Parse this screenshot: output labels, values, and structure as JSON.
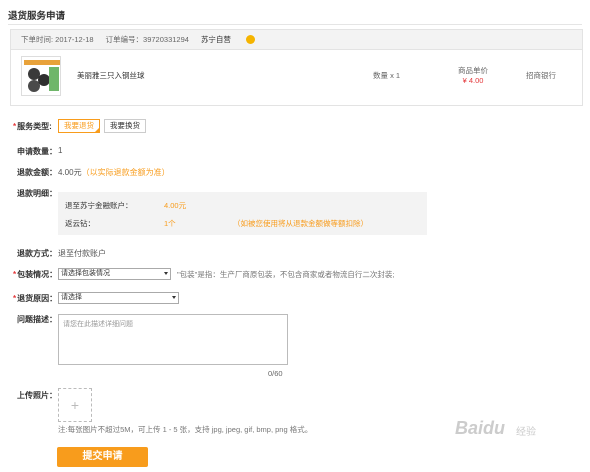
{
  "page": {
    "title": "退货服务申请"
  },
  "order": {
    "date": "下单时间: 2017-12-18",
    "order_no": "订单编号：39720331294",
    "store": "苏宁自营",
    "product_name": "美丽雅三只入钢丝球",
    "qty": "数量 x 1",
    "price_label": "商品单价",
    "price": "¥ 4.00",
    "seller": "招商银行"
  },
  "form": {
    "service_type": {
      "label": "服务类型:",
      "options": [
        "我要退货",
        "我要换货"
      ],
      "selected": "我要退货"
    },
    "apply_qty": {
      "label": "申请数量：",
      "value": "1"
    },
    "refund_amount": {
      "label": "退款金额：",
      "value": "4.00元",
      "note": "（以实际退款金额为准）"
    },
    "refund_detail": {
      "label": "退款明细：",
      "rows": [
        {
          "name": "退至苏宁金融账户：",
          "amount": "4.00元",
          "note": ""
        },
        {
          "name": "返云钻：",
          "amount": "1个",
          "note": "（如被您使用将从退款金额做等额扣除）"
        }
      ]
    },
    "refund_method": {
      "label": "退款方式：",
      "value": "退至付款账户"
    },
    "package": {
      "label": "包装情况：",
      "placeholder": "请选择包装情况",
      "hint": "\"包装\"是指：生产厂商原包装，不包含商家或者物流自行二次封装;"
    },
    "reason": {
      "label": "退货原因：",
      "placeholder": "请选择"
    },
    "description": {
      "label": "问题描述：",
      "placeholder": "请您在此描述详细问题",
      "counter": "0/60"
    },
    "upload": {
      "label": "上传照片：",
      "plus": "+",
      "hint": "注:每张图片不超过5M，可上传 1 - 5 张，支持 jpg, jpeg, gif, bmp, png 格式。"
    },
    "submit_label": "提交申请"
  },
  "watermark": {
    "text": "Baidu",
    "sub": "经验"
  },
  "colors": {
    "accent": "#f89c1c",
    "price": "#e4393c"
  }
}
